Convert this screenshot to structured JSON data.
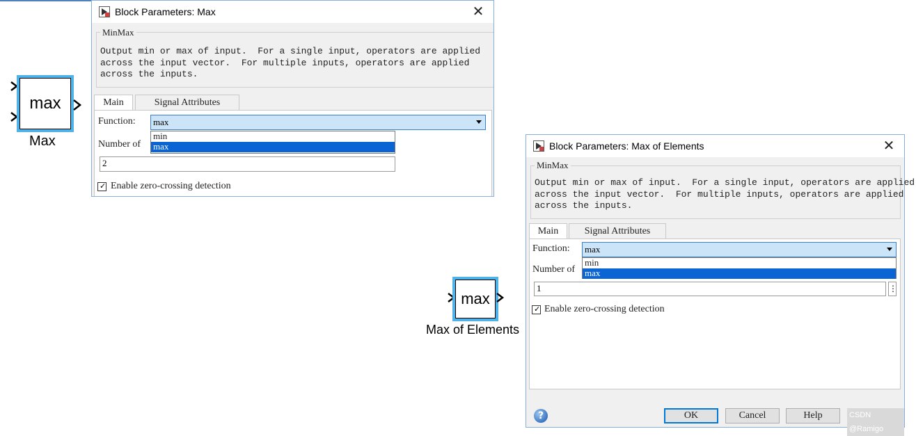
{
  "blocks": {
    "max": {
      "text": "max",
      "caption": "Max"
    },
    "max_of_elements": {
      "text": "max",
      "caption": "Max of Elements"
    }
  },
  "dialog1": {
    "title": "Block Parameters: Max",
    "close_glyph": "✕",
    "group_legend": "MinMax",
    "description": "Output min or max of input.  For a single input, operators are applied\nacross the input vector.  For multiple inputs, operators are applied\nacross the inputs.",
    "tabs": [
      {
        "label": "Main"
      },
      {
        "label": "Signal Attributes"
      }
    ],
    "function_label": "Function:",
    "function_value": "max",
    "dropdown_options": [
      "min",
      "max"
    ],
    "number_label": "Number of",
    "number_value": "2",
    "zero_crossing_label": "Enable zero-crossing detection",
    "zero_crossing_checked": true
  },
  "dialog2": {
    "title": "Block Parameters: Max of Elements",
    "close_glyph": "✕",
    "group_legend": "MinMax",
    "description": "Output min or max of input.  For a single input, operators are applied\nacross the input vector.  For multiple inputs, operators are applied\nacross the inputs.",
    "tabs": [
      {
        "label": "Main"
      },
      {
        "label": "Signal Attributes"
      }
    ],
    "function_label": "Function:",
    "function_value": "max",
    "dropdown_options": [
      "min",
      "max"
    ],
    "number_label": "Number of",
    "number_value": "1",
    "zero_crossing_label": "Enable zero-crossing detection",
    "zero_crossing_checked": true,
    "buttons": {
      "ok": "OK",
      "cancel": "Cancel",
      "help": "Help"
    },
    "help_icon_glyph": "?"
  },
  "watermark": "CSDN @Ramigo",
  "colors": {
    "selection": "#0a64d3",
    "select_bg": "#cce4f7",
    "block_highlight": "#4fb3ea",
    "dialog_bg": "#f0f0f0"
  },
  "icons": {
    "block_icon": "simulink-block-icon",
    "close": "close-icon",
    "help": "help-icon",
    "checkbox": "checkbox-icon"
  }
}
